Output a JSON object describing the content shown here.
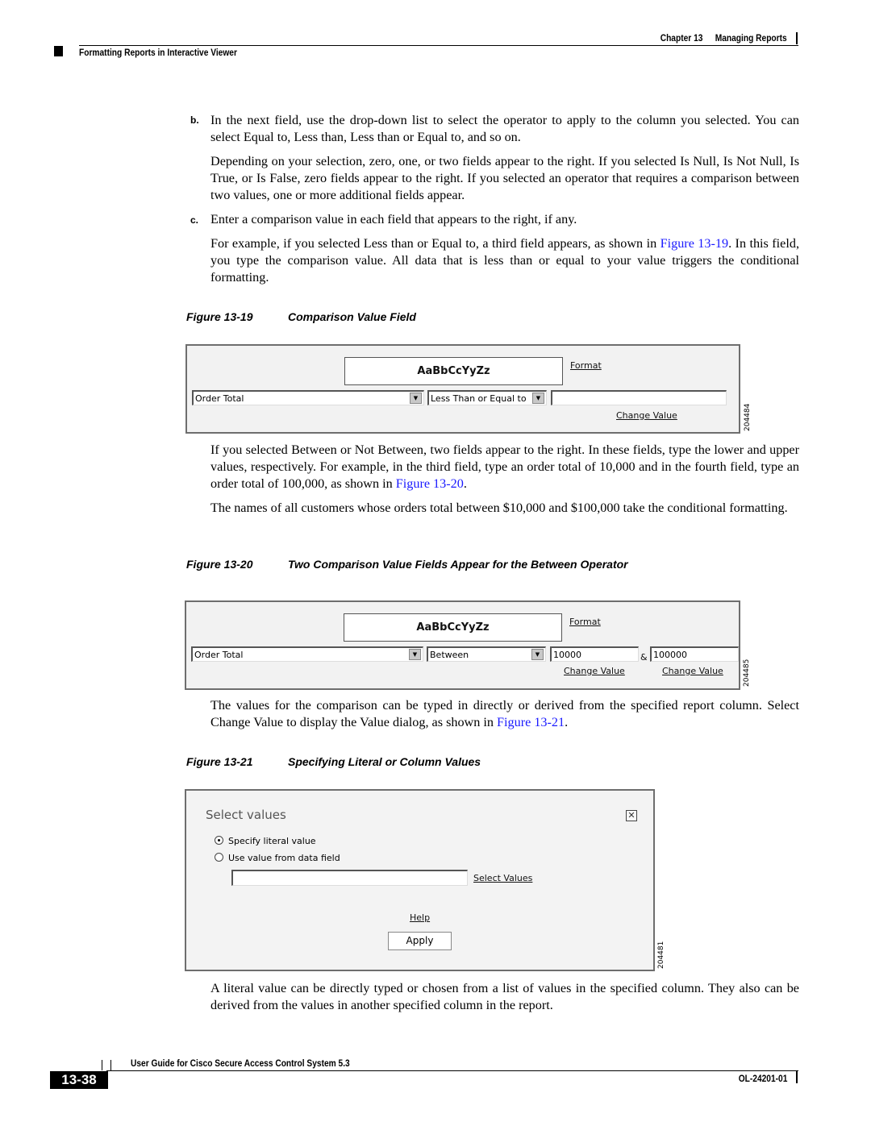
{
  "header": {
    "chapter_label": "Chapter 13",
    "chapter_title": "Managing Reports",
    "section_title": "Formatting Reports in Interactive Viewer"
  },
  "body": {
    "step_b_letter": "b.",
    "step_b_text": "In the next field, use the drop-down list to select the operator to apply to the column you selected. You can select Equal to, Less than, Less than or Equal to, and so on.",
    "step_b_detail": "Depending on your selection, zero, one, or two fields appear to the right. If you selected Is Null, Is Not Null, Is True, or Is False, zero fields appear to the right. If you selected an operator that requires a comparison between two values, one or more additional fields appear.",
    "step_c_letter": "c.",
    "step_c_text": "Enter a comparison value in each field that appears to the right, if any.",
    "example_before": "For example, if you selected Less than or Equal to, a third field appears, as shown in ",
    "example_link": "Figure 13-19",
    "example_after": ". In this field, you type the comparison value. All data that is less than or equal to your value triggers the conditional formatting.",
    "between_before": "If you selected Between or Not Between, two fields appear to the right. In these fields, type the lower and upper values, respectively. For example, in the third field, type an order total of 10,000 and in the fourth field, type an order total of 100,000, as shown in ",
    "between_link": "Figure 13-20",
    "between_after": ".",
    "names_text": "The names of all customers whose orders total between $10,000 and $100,000 take the conditional formatting.",
    "values_before": "The values for the comparison can be typed in directly or derived from the specified report column. Select Change Value to display the Value dialog, as shown in ",
    "values_link": "Figure 13-21",
    "values_after": ".",
    "literal_text": "A literal value can be directly typed or chosen from a list of values in the specified column. They also can be derived from the values in another specified column in the report."
  },
  "figures": [
    {
      "number": "Figure 13-19",
      "caption": "Comparison Value Field",
      "id": "204484",
      "preview_text": "AaBbCcYyZz",
      "format_link": "Format",
      "column_select": "Order Total",
      "operator_select": "Less Than or Equal to",
      "value1": "",
      "change_value_link": "Change Value"
    },
    {
      "number": "Figure 13-20",
      "caption": "Two Comparison Value Fields Appear for the Between Operator",
      "id": "204485",
      "preview_text": "AaBbCcYyZz",
      "format_link": "Format",
      "column_select": "Order Total",
      "operator_select": "Between",
      "value1": "10000",
      "separator": "&",
      "value2": "100000",
      "change_value_link_1": "Change Value",
      "change_value_link_2": "Change Value"
    },
    {
      "number": "Figure 13-21",
      "caption": "Specifying Literal or Column Values",
      "id": "204481",
      "dialog_title": "Select values",
      "close_symbol": "✕",
      "radio_options": [
        {
          "label": "Specify literal value",
          "checked": true
        },
        {
          "label": "Use value from data field",
          "checked": false
        }
      ],
      "value_input": "",
      "select_values_link": "Select Values",
      "help_link": "Help",
      "apply_button": "Apply"
    }
  ],
  "footer": {
    "guide_title": "User Guide for Cisco Secure Access Control System 5.3",
    "page_number": "13-38",
    "doc_number": "OL-24201-01"
  }
}
